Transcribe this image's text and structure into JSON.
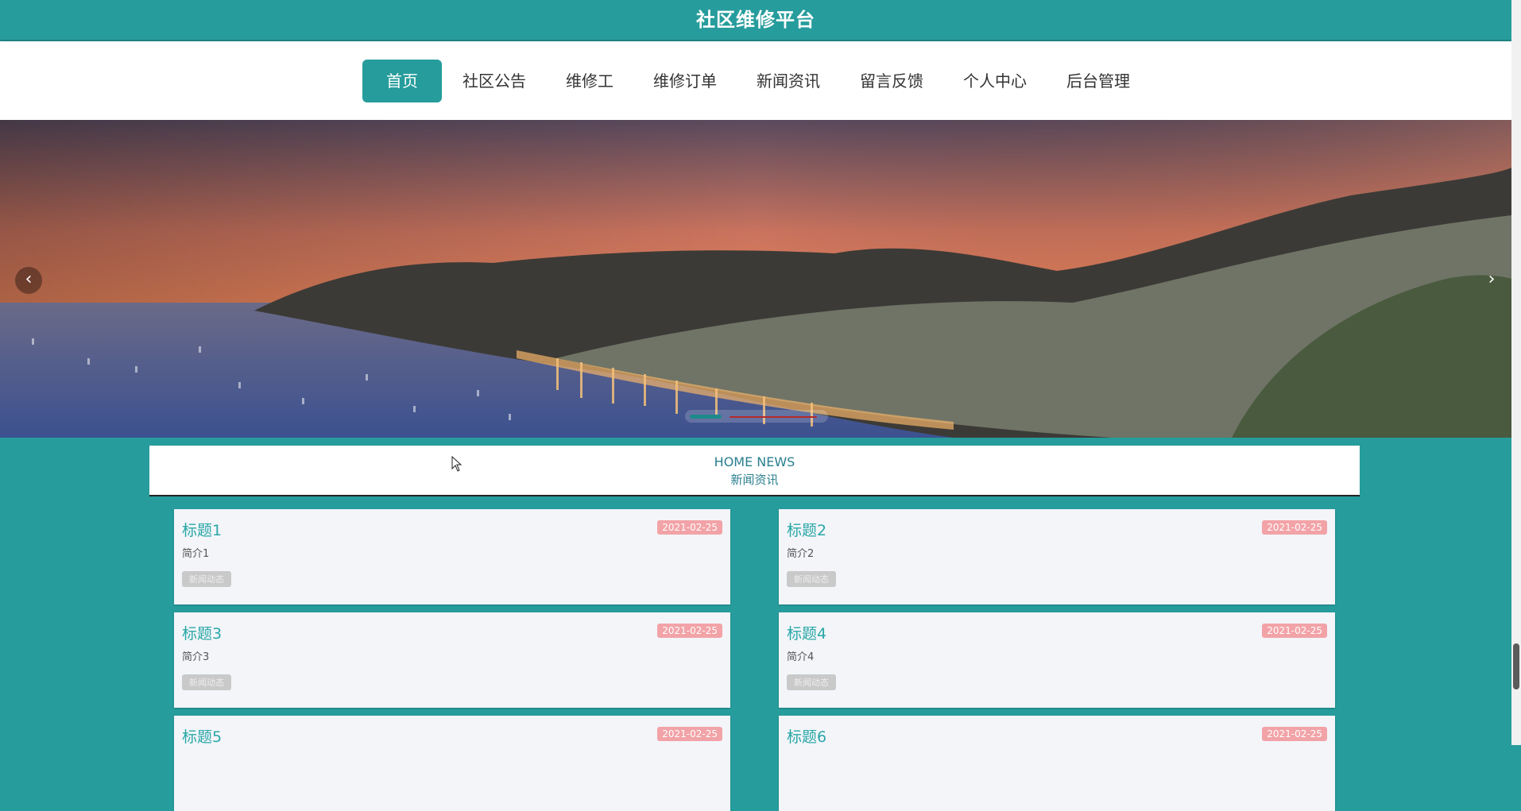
{
  "site": {
    "title": "社区维修平台"
  },
  "nav": {
    "items": [
      {
        "label": "首页",
        "active": true
      },
      {
        "label": "社区公告"
      },
      {
        "label": "维修工"
      },
      {
        "label": "维修订单"
      },
      {
        "label": "新闻资讯"
      },
      {
        "label": "留言反馈"
      },
      {
        "label": "个人中心"
      },
      {
        "label": "后台管理"
      }
    ]
  },
  "carousel": {
    "prev_icon": "chevron-left-icon",
    "next_icon": "chevron-right-icon",
    "prev_glyph": "‹",
    "next_glyph": "›",
    "active_index": 0,
    "indicator_colors": [
      "#1d8a8a",
      "#b52a2a"
    ]
  },
  "news_section": {
    "heading_en": "HOME NEWS",
    "heading_cn": "新闻资讯",
    "cards": [
      {
        "title": "标题1",
        "date": "2021-02-25",
        "summary": "简介1",
        "tag": "新闻动态"
      },
      {
        "title": "标题2",
        "date": "2021-02-25",
        "summary": "简介2",
        "tag": "新闻动态"
      },
      {
        "title": "标题3",
        "date": "2021-02-25",
        "summary": "简介3",
        "tag": "新闻动态"
      },
      {
        "title": "标题4",
        "date": "2021-02-25",
        "summary": "简介4",
        "tag": "新闻动态"
      },
      {
        "title": "标题5",
        "date": "2021-02-25",
        "summary": "",
        "tag": ""
      },
      {
        "title": "标题6",
        "date": "2021-02-25",
        "summary": "",
        "tag": ""
      }
    ]
  },
  "colors": {
    "primary": "#279c9c",
    "date_badge": "#f2a3a7",
    "card_bg": "#f3f5f9"
  }
}
